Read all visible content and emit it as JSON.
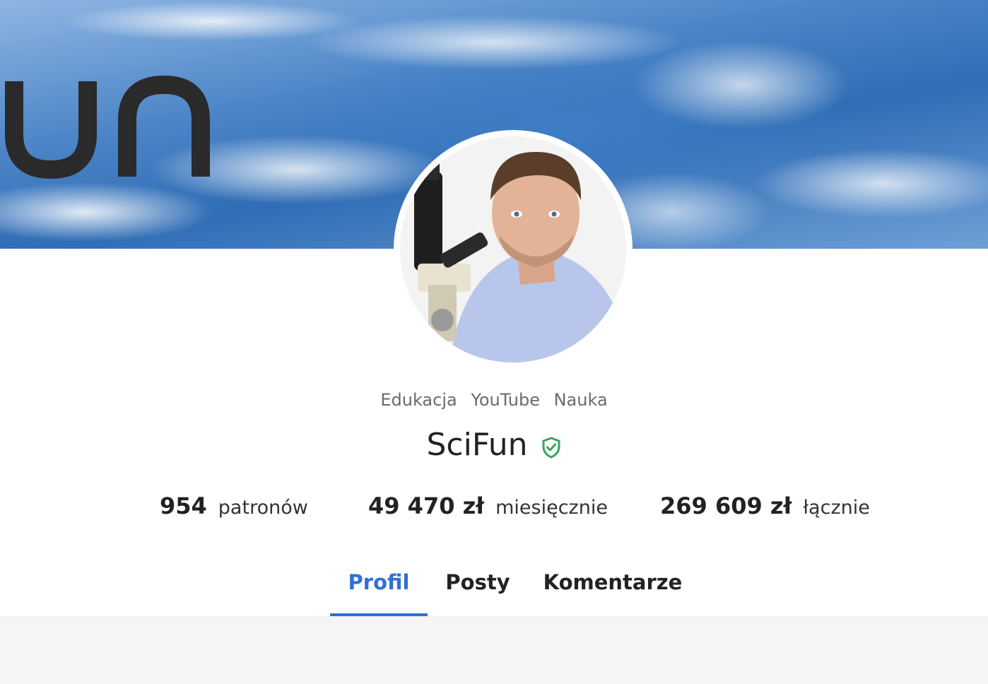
{
  "banner": {
    "logo_text": "un"
  },
  "profile": {
    "tags": [
      "Edukacja",
      "YouTube",
      "Nauka"
    ],
    "name": "SciFun",
    "verified": true
  },
  "stats": [
    {
      "value": "954",
      "label": "patronów"
    },
    {
      "value": "49 470 zł",
      "label": "miesięcznie"
    },
    {
      "value": "269 609 zł",
      "label": "łącznie"
    }
  ],
  "tabs": [
    {
      "label": "Profil",
      "active": true
    },
    {
      "label": "Posty",
      "active": false
    },
    {
      "label": "Komentarze",
      "active": false
    }
  ],
  "colors": {
    "accent": "#2f6fd6",
    "verified": "#3aa35c"
  },
  "icons": {
    "verified": "shield-check-icon"
  }
}
